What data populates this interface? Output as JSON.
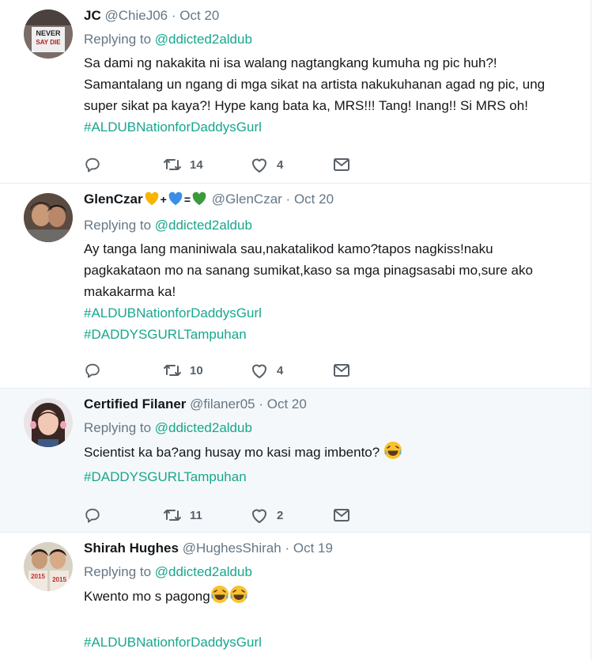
{
  "tweets": [
    {
      "name": "JC",
      "handle": "@ChieJ06",
      "dot": "·",
      "date": "Oct 20",
      "replying_prefix": "Replying to",
      "replying_to": "@ddicted2aldub",
      "lines": [
        "Sa dami ng nakakita ni isa walang nagtangkang kumuha ng pic huh?!",
        "Samantalang un ngang di mga sikat na artista nakukuhanan agad ng pic, ung",
        "super sikat pa kaya?! Hype kang bata ka, MRS!!! Tang! Inang!! Si MRS oh!"
      ],
      "hashtags": [
        "#ALDUBNationforDaddysGurl"
      ],
      "retweets": "14",
      "likes": "4",
      "avatar_text": [
        "NEVER",
        "SAY DIE"
      ]
    },
    {
      "name": "GlenCzar",
      "name_emoji": [
        "yellow-heart",
        "+",
        "blue-heart",
        "=",
        "green-heart"
      ],
      "handle": "@GlenCzar",
      "dot": "·",
      "date": "Oct 20",
      "replying_prefix": "Replying to",
      "replying_to": "@ddicted2aldub",
      "lines": [
        "Ay tanga lang maniniwala sau,nakatalikod kamo?tapos nagkiss!naku",
        "pagkakataon mo na sanang sumikat,kaso sa mga pinagsasabi mo,sure ako",
        "makakarma ka!"
      ],
      "hashtags": [
        "#ALDUBNationforDaddysGurl",
        "#DADDYSGURLTampuhan"
      ],
      "retweets": "10",
      "likes": "4"
    },
    {
      "name": "Certified Filaner",
      "handle": "@filaner05",
      "dot": "·",
      "date": "Oct 20",
      "replying_prefix": "Replying to",
      "replying_to": "@ddicted2aldub",
      "lines": [
        "Scientist ka ba?ang husay mo kasi mag imbento? "
      ],
      "hashtags": [
        "#DADDYSGURLTampuhan"
      ],
      "retweets": "11",
      "likes": "2"
    },
    {
      "name": "Shirah Hughes",
      "handle": "@HughesShirah",
      "dot": "·",
      "date": "Oct 19",
      "replying_prefix": "Replying to",
      "replying_to": "@ddicted2aldub",
      "lines": [
        "Kwento mo s pagong"
      ],
      "hashtags": [
        "#ALDUBNationforDaddysGurl"
      ],
      "avatar_text": [
        "2015",
        "2015"
      ]
    }
  ],
  "colors": {
    "accent": "#17a78c",
    "muted": "#657786",
    "highlight_bg": "#f5f8fa",
    "divider": "#e6ecf0"
  },
  "icons": [
    "reply-icon",
    "retweet-icon",
    "like-icon",
    "message-icon",
    "laughing-emoji",
    "yellow-heart-emoji",
    "blue-heart-emoji",
    "green-heart-emoji"
  ]
}
